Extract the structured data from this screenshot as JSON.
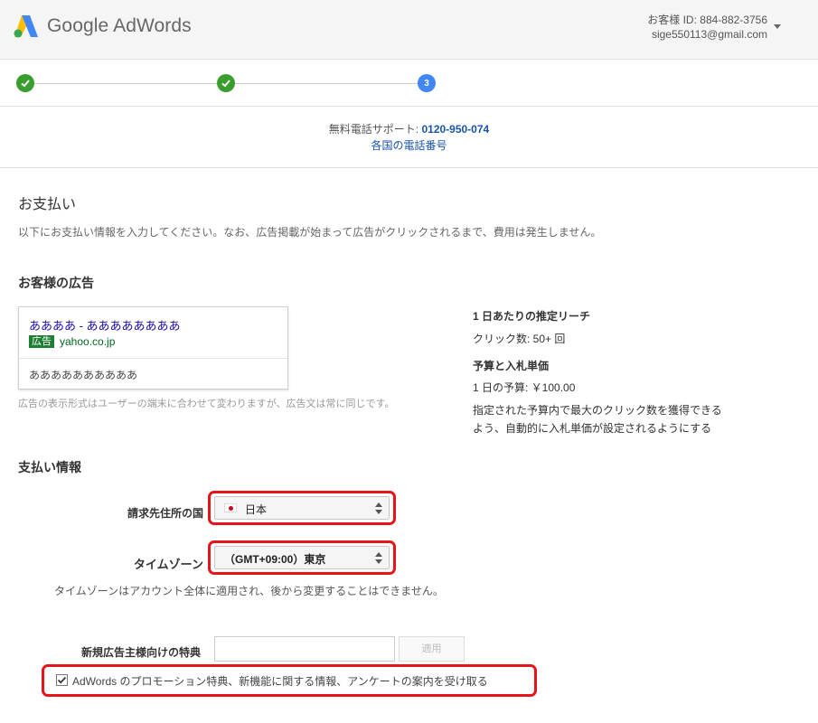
{
  "header": {
    "logo_text": "Google AdWords",
    "customer_id": "お客様 ID: 884-882-3756",
    "email": "sige550113@gmail.com"
  },
  "stepper": {
    "current_step": "3"
  },
  "support": {
    "label": "無料電話サポート: ",
    "phone": "0120-950-074",
    "link": "各国の電話番号"
  },
  "payment": {
    "title": "お支払い",
    "description": "以下にお支払い情報を入力してください。なお、広告掲載が始まって広告がクリックされるまで、費用は発生しません。"
  },
  "ad_section": {
    "title": "お客様の広告",
    "headline": "ああああ - ああああああああ",
    "badge": "広告",
    "url": "yahoo.co.jp",
    "description": "ああああああああああ",
    "note": "広告の表示形式はユーザーの端末に合わせて変わりますが、広告文は常に同じです。"
  },
  "estimate": {
    "reach_title": "1 日あたりの推定リーチ",
    "clicks": "クリック数: 50+ 回",
    "budget_title": "予算と入札単価",
    "daily_budget": "1 日の予算: ￥100.00",
    "auto_bid_line1": "指定された予算内で最大のクリック数を獲得できる",
    "auto_bid_line2": "よう、自動的に入札単価が設定されるようにする"
  },
  "billing": {
    "title": "支払い情報",
    "country_label": "請求先住所の国",
    "country_value": "日本",
    "timezone_label": "タイムゾーン",
    "timezone_value": "（GMT+09:00）東京",
    "timezone_note": "タイムゾーンはアカウント全体に適用され、後から変更することはできません。",
    "promo_label": "新規広告主様向けの特典",
    "promo_placeholder": "",
    "apply_label": "適用",
    "opt_in_label": "AdWords のプロモーション特典、新機能に関する情報、アンケートの案内を受け取る",
    "opt_in_checked": true
  },
  "colors": {
    "highlight": "#e8141b",
    "step_done": "#3a9e2f",
    "step_current": "#4285f4",
    "link": "#1a55a8"
  }
}
